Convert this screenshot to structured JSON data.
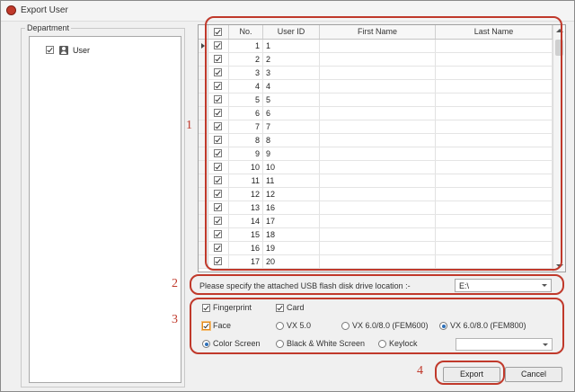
{
  "window": {
    "title": "Export User"
  },
  "department": {
    "legend": "Department",
    "tree": [
      {
        "label": "User",
        "checked": true,
        "icon": "user-icon"
      }
    ]
  },
  "grid": {
    "headers": [
      "No.",
      "User ID",
      "First Name",
      "Last Name"
    ],
    "header_checked": true,
    "rows": [
      {
        "no": "1",
        "user_id": "1",
        "first": "",
        "last": "",
        "checked": true
      },
      {
        "no": "2",
        "user_id": "2",
        "first": "",
        "last": "",
        "checked": true
      },
      {
        "no": "3",
        "user_id": "3",
        "first": "",
        "last": "",
        "checked": true
      },
      {
        "no": "4",
        "user_id": "4",
        "first": "",
        "last": "",
        "checked": true
      },
      {
        "no": "5",
        "user_id": "5",
        "first": "",
        "last": "",
        "checked": true
      },
      {
        "no": "6",
        "user_id": "6",
        "first": "",
        "last": "",
        "checked": true
      },
      {
        "no": "7",
        "user_id": "7",
        "first": "",
        "last": "",
        "checked": true
      },
      {
        "no": "8",
        "user_id": "8",
        "first": "",
        "last": "",
        "checked": true
      },
      {
        "no": "9",
        "user_id": "9",
        "first": "",
        "last": "",
        "checked": true
      },
      {
        "no": "10",
        "user_id": "10",
        "first": "",
        "last": "",
        "checked": true
      },
      {
        "no": "11",
        "user_id": "11",
        "first": "",
        "last": "",
        "checked": true
      },
      {
        "no": "12",
        "user_id": "12",
        "first": "",
        "last": "",
        "checked": true
      },
      {
        "no": "13",
        "user_id": "16",
        "first": "",
        "last": "",
        "checked": true
      },
      {
        "no": "14",
        "user_id": "17",
        "first": "",
        "last": "",
        "checked": true
      },
      {
        "no": "15",
        "user_id": "18",
        "first": "",
        "last": "",
        "checked": true
      },
      {
        "no": "16",
        "user_id": "19",
        "first": "",
        "last": "",
        "checked": true
      },
      {
        "no": "17",
        "user_id": "20",
        "first": "",
        "last": "",
        "checked": true
      }
    ]
  },
  "usb": {
    "label": "Please specify the attached USB flash disk drive location :-",
    "drive": "E:\\"
  },
  "options": {
    "fingerprint": {
      "label": "Fingerprint",
      "checked": true
    },
    "card": {
      "label": "Card",
      "checked": true
    },
    "face": {
      "label": "Face",
      "checked": true
    },
    "vx50": {
      "label": "VX 5.0",
      "selected": false
    },
    "vx60_fem600": {
      "label": "VX 6.0/8.0 (FEM600)",
      "selected": false
    },
    "vx60_fem800": {
      "label": "VX 6.0/8.0 (FEM800)",
      "selected": true
    },
    "color_screen": {
      "label": "Color Screen",
      "selected": true
    },
    "bw_screen": {
      "label": "Black & White Screen",
      "selected": false
    },
    "keylock": {
      "label": "Keylock",
      "selected": false
    },
    "keylock_value": ""
  },
  "buttons": {
    "export": "Export",
    "cancel": "Cancel"
  },
  "annotations": [
    "1",
    "2",
    "3",
    "4"
  ],
  "colors": {
    "annotation": "#c0392b",
    "radio_selected": "#2d6fb8",
    "title_icon": "#c0392b"
  }
}
